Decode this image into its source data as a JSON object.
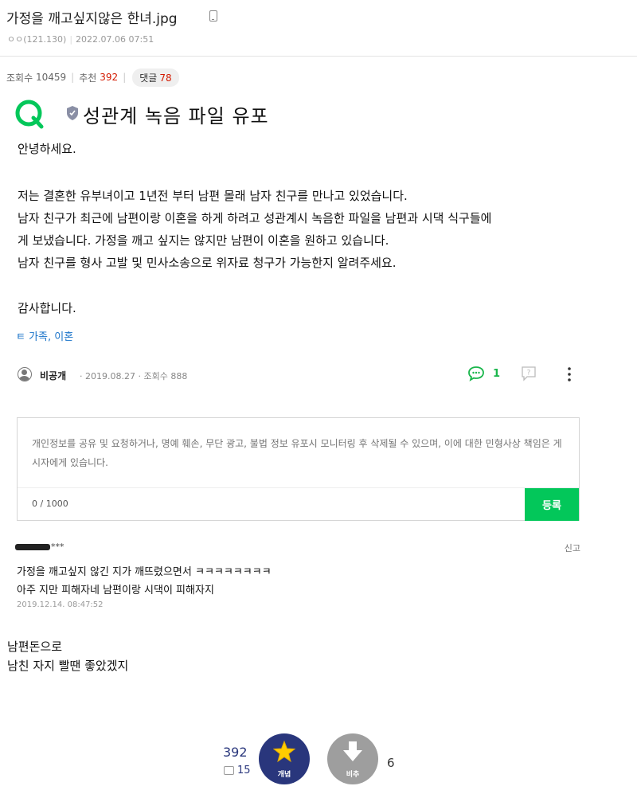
{
  "post": {
    "title": "가정을 깨고싶지않은 한녀.jpg",
    "author": "ㅇㅇ(121.130)",
    "date": "2022.07.06 07:51"
  },
  "stats": {
    "views_label": "조회수",
    "views": "10459",
    "recommend_label": "추천",
    "recommend": "392",
    "comments_label": "댓글",
    "comments": "78"
  },
  "qna": {
    "title": "성관계 녹음 파일 유포",
    "greeting": "안녕하세요.",
    "line1": "저는 결혼한 유부녀이고 1년전 부터 남편 몰래  남자 친구를 만나고 있었습니다.",
    "line2": "남자 친구가 최근에 남편이랑 이혼을 하게 하려고 성관계시 녹음한 파일을 남편과 시댁 식구들에",
    "line3": "게 보냈습니다. 가정을 깨고 싶지는 않지만 남편이 이혼을 원하고 있습니다.",
    "line4": "남자 친구를 형사 고발 및 민사소송으로 위자료 청구가 가능한지 알려주세요.",
    "closing": "감사합니다.",
    "category": "ㅌ 가족, 이혼",
    "author": "비공개",
    "date": "2019.08.27",
    "views": "조회수 888",
    "comment_count": "1",
    "colors": {
      "logo_green": "#03c75a",
      "link_blue": "#1a73c9"
    }
  },
  "comment_form": {
    "placeholder": "개인정보를 공유 및 요청하거나, 명예 훼손, 무단 광고, 불법 정보 유포시 모니터링 후 삭제될 수 있으며, 이에 대한 민형사상 책임은 게시자에게 있습니다.",
    "char_count": "0 / 1000",
    "submit_label": "등록"
  },
  "reply": {
    "author_suffix": "***",
    "report_label": "신고",
    "line1": "가정을 깨고싶지 않긴 지가 깨뜨렸으면서 ㅋㅋㅋㅋㅋㅋㅋㅋ",
    "line2": "아주 지만 피해자네 남편이랑 시댁이 피해자지",
    "date": "2019.12.14. 08:47:52"
  },
  "caption": {
    "line1": "남편돈으로",
    "line2": "남친 자지 빨땐 좋았겠지"
  },
  "vote": {
    "up_count": "392",
    "up_sub_count": "15",
    "up_label": "개념",
    "down_label": "비추",
    "down_count": "6",
    "colors": {
      "up": "#29367c",
      "down": "#9e9e9e",
      "star": "#ffcc00"
    }
  }
}
